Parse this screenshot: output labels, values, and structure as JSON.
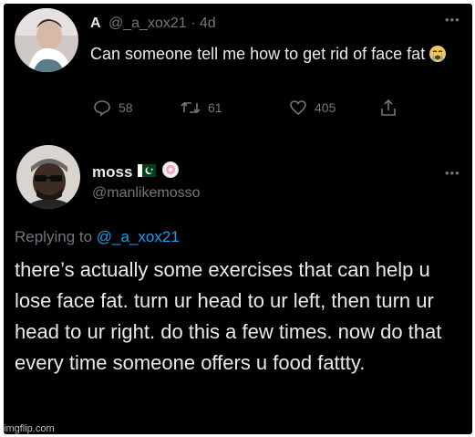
{
  "tweet1": {
    "display_name": "A",
    "handle": "@_a_xox21",
    "separator": "·",
    "age": "4d",
    "text": "Can someone tell me how to get rid of face fat",
    "emoji": "crying-face-emoji",
    "actions": {
      "reply_count": "58",
      "retweet_count": "61",
      "like_count": "405"
    }
  },
  "tweet2": {
    "display_name": "moss",
    "flag": "pakistan-flag",
    "badge": "cookie-badge",
    "handle": "@manlikemosso",
    "replying_prefix": "Replying to",
    "replying_mention": "@_a_xox21",
    "text": "there’s actually some exercises that can help u lose face fat. turn ur head to ur left, then turn ur head to ur right. do this a few times. now do that every time someone offers u food fattty."
  },
  "watermark": "imgflip.com",
  "colors": {
    "background": "#000000",
    "text": "#e7e9ea",
    "secondary": "#71767b",
    "link": "#1d9bf0"
  }
}
